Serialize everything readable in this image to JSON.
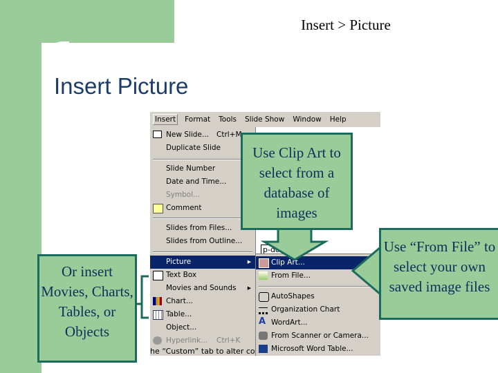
{
  "header": {
    "breadcrumb": "Insert > Picture",
    "title": "Insert Picture"
  },
  "menubar": [
    "Insert",
    "Format",
    "Tools",
    "Slide Show",
    "Window",
    "Help"
  ],
  "insert_menu": [
    {
      "label": "New Slide...",
      "shortcut": "Ctrl+M",
      "icon": "new-slide-icon"
    },
    {
      "label": "Duplicate Slide"
    },
    {
      "label": "Slide Number"
    },
    {
      "label": "Date and Time..."
    },
    {
      "label": "Symbol...",
      "disabled": true
    },
    {
      "label": "Comment",
      "icon": "comment-icon"
    },
    {
      "label": "Slides from Files..."
    },
    {
      "label": "Slides from Outline..."
    },
    {
      "label": "Picture",
      "submenu": true,
      "selected": true
    },
    {
      "label": "Text Box",
      "icon": "text-box-icon"
    },
    {
      "label": "Movies and Sounds",
      "submenu": true
    },
    {
      "label": "Chart...",
      "icon": "chart-icon"
    },
    {
      "label": "Table...",
      "icon": "table-icon"
    },
    {
      "label": "Object..."
    },
    {
      "label": "Hyperlink...",
      "shortcut": "Ctrl+K",
      "disabled": true,
      "icon": "hyperlink-icon"
    }
  ],
  "picture_submenu": [
    {
      "label": "Clip Art...",
      "selected": true,
      "icon": "clip-art-icon"
    },
    {
      "label": "From File...",
      "icon": "from-file-icon"
    },
    {
      "label": "AutoShapes",
      "icon": "autoshapes-icon"
    },
    {
      "label": "Organization Chart",
      "icon": "org-chart-icon"
    },
    {
      "label": "WordArt...",
      "icon": "wordart-icon"
    },
    {
      "label": "From Scanner or Camera...",
      "icon": "scanner-icon"
    },
    {
      "label": "Microsoft Word Table...",
      "icon": "word-table-icon"
    }
  ],
  "background_text": {
    "dropdown": "p-down",
    "bottom": "he “Custom” tab to alter co"
  },
  "callouts": {
    "clip_art": "Use Clip Art to select from a database of images",
    "from_file": "Use “From File” to select your own saved image files",
    "other": "Or insert Movies, Charts, Tables, or Objects"
  },
  "colors": {
    "green": "#99cc99",
    "teal_border": "#1b6b5c",
    "menu_highlight": "#0a246a"
  }
}
